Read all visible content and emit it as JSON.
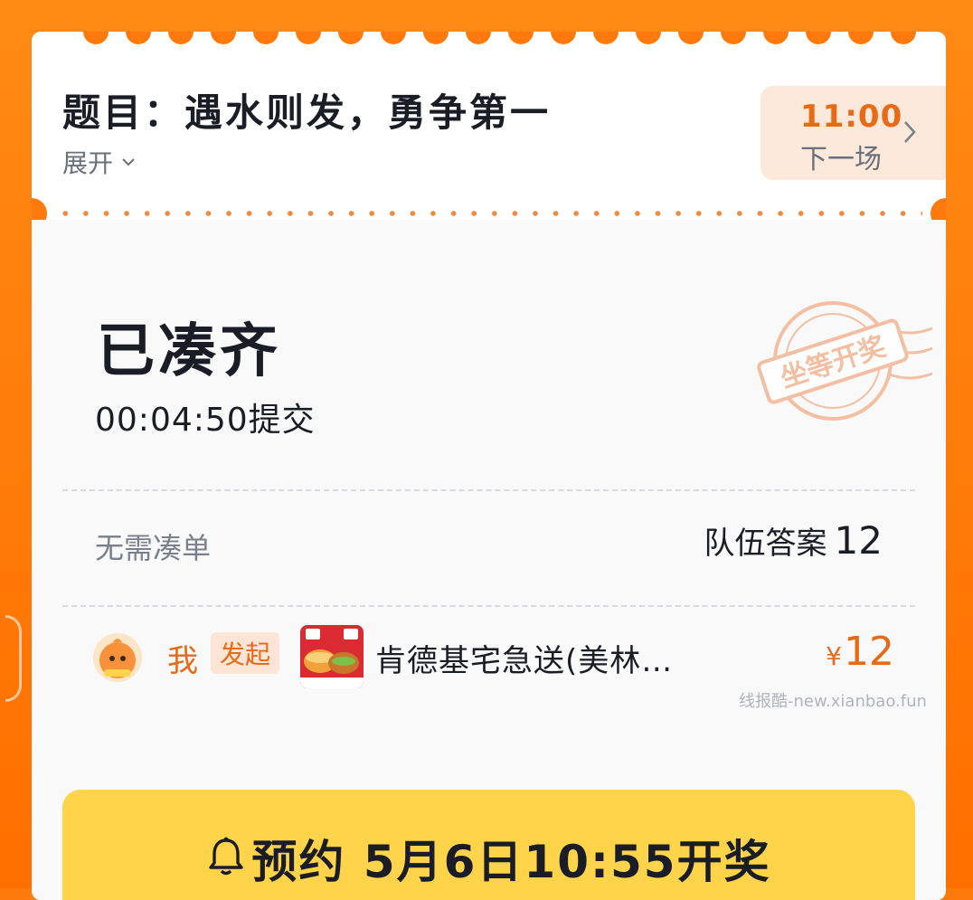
{
  "header": {
    "title": "题目：遇水则发，勇争第一",
    "expand_label": "展开",
    "next_session": {
      "time": "11:00",
      "label": "下一场"
    }
  },
  "status": {
    "title": "已凑齐",
    "submit_info": "00:04:50提交",
    "stamp_text": "坐等开奖"
  },
  "order_info": {
    "no_need_label": "无需凑单",
    "team_answer_label": "队伍答案",
    "team_answer_value": "12"
  },
  "member": {
    "name": "我",
    "badge": "发起",
    "product_name": "肯德基宅急送(美林…",
    "price_symbol": "¥",
    "price_value": "12"
  },
  "watermark": "线报酷-new.xianbao.fun",
  "cta": {
    "label": "预约  5月6日10:55开奖"
  },
  "colors": {
    "brand_orange": "#ff7a0c",
    "accent_text": "#e96a16",
    "cta_yellow": "#ffd34a",
    "stamp": "#f3b695"
  }
}
